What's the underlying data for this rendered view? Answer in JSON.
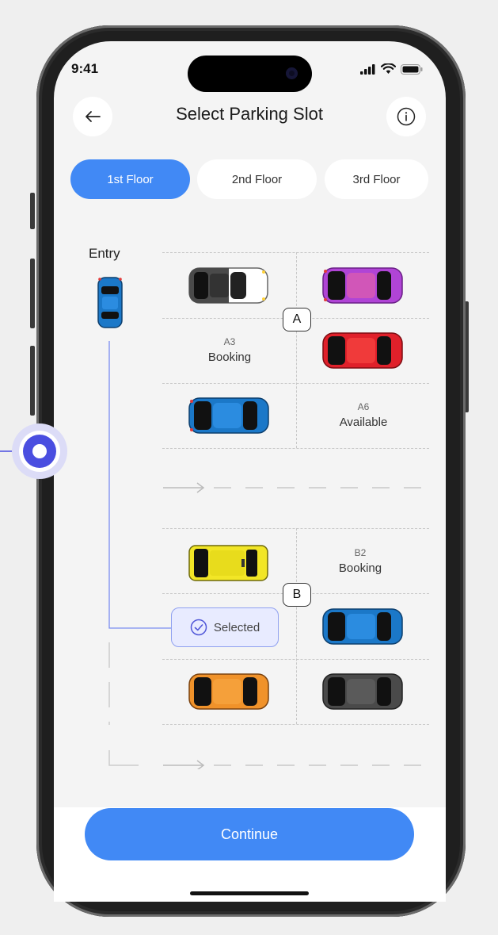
{
  "status_bar": {
    "time": "9:41"
  },
  "header": {
    "title": "Select Parking Slot",
    "back_icon": "arrow-left-icon",
    "info_icon": "info-icon"
  },
  "floors": [
    {
      "label": "1st Floor",
      "active": true
    },
    {
      "label": "2nd Floor",
      "active": false
    },
    {
      "label": "3rd Floor",
      "active": false
    }
  ],
  "map": {
    "entry_label": "Entry",
    "sections": [
      {
        "name": "A",
        "slots": [
          {
            "id": "A1",
            "state": "occupied",
            "car_color": "#4a4a4a"
          },
          {
            "id": "A2",
            "state": "occupied",
            "car_color": "#b044d6"
          },
          {
            "id": "A3",
            "state": "Booking",
            "label": "A3",
            "status": "Booking"
          },
          {
            "id": "A4",
            "state": "occupied",
            "car_color": "#e0202a"
          },
          {
            "id": "A5",
            "state": "occupied",
            "car_color": "#1b78c8"
          },
          {
            "id": "A6",
            "state": "Available",
            "label": "A6",
            "status": "Available"
          }
        ]
      },
      {
        "name": "B",
        "slots": [
          {
            "id": "B1",
            "state": "occupied",
            "car_color": "#f2e626"
          },
          {
            "id": "B2",
            "state": "Booking",
            "label": "B2",
            "status": "Booking"
          },
          {
            "id": "B3",
            "state": "Selected",
            "status": "Selected"
          },
          {
            "id": "B4",
            "state": "occupied",
            "car_color": "#1b78c8"
          },
          {
            "id": "B5",
            "state": "occupied",
            "car_color": "#f0922a"
          },
          {
            "id": "B6",
            "state": "occupied",
            "car_color": "#4a4a4a"
          }
        ]
      }
    ]
  },
  "continue_label": "Continue",
  "colors": {
    "accent": "#4189f5",
    "selected_bg": "#e8ebff",
    "selected_border": "#8fa0f0",
    "pin": "#4a4ee0"
  }
}
